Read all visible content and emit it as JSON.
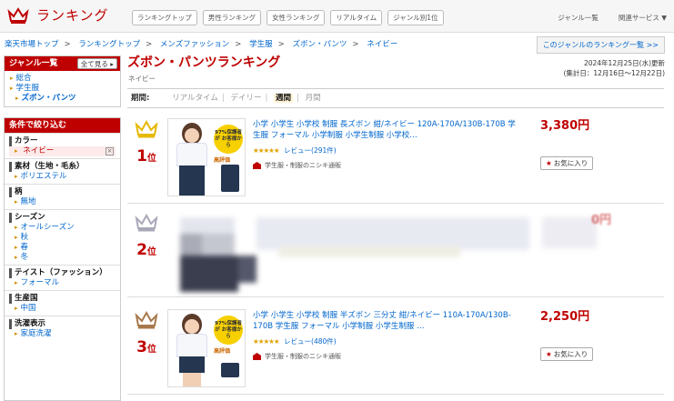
{
  "header": {
    "logo_text": "ランキング",
    "tabs": [
      "ランキングトップ",
      "男性ランキング",
      "女性ランキング",
      "リアルタイム",
      "ジャンル別1位"
    ],
    "right_links": [
      "ジャンル一覧",
      "関連サービス ▼"
    ]
  },
  "breadcrumb": [
    "楽天市場トップ",
    "ランキングトップ",
    "メンズファッション",
    "学生服",
    "ズボン・パンツ",
    "ネイビー"
  ],
  "ranking_link": "このジャンルのランキング一覧 >>",
  "sidebar": {
    "genre_title": "ジャンル一覧",
    "see_all": "全て見る",
    "genre_items": [
      "総合",
      "学生服",
      "ズボン・パンツ"
    ],
    "filter_title": "条件で絞り込む",
    "groups": [
      {
        "title": "カラー",
        "items": [
          "ネイビー"
        ]
      },
      {
        "title": "素材（生地・毛糸）",
        "items": [
          "ポリエステル"
        ]
      },
      {
        "title": "柄",
        "items": [
          "無地"
        ]
      },
      {
        "title": "シーズン",
        "items": [
          "オールシーズン",
          "秋",
          "春",
          "冬"
        ]
      },
      {
        "title": "テイスト（ファッション）",
        "items": [
          "フォーマル"
        ]
      },
      {
        "title": "生産国",
        "items": [
          "中国"
        ]
      },
      {
        "title": "洗濯表示",
        "items": [
          "家庭洗濯"
        ]
      }
    ]
  },
  "main": {
    "title": "ズボン・パンツランキング",
    "subtitle": "ネイビー",
    "updated": "2024年12月25日(水)更新",
    "period_range": "(集計日：12月16日～12月22日)",
    "period_label": "期間:",
    "period_options": [
      "リアルタイム",
      "デイリー",
      "週間",
      "月間"
    ],
    "items": [
      {
        "rank": "1",
        "rank_suffix": "位",
        "title": "小学 小学生 小学校 制服 長ズボン 紺/ネイビー 120A-170A/130B-170B 学生服 フォーマル 小学制服 小学生制服 小学校…",
        "stars": "★★★★★",
        "review": "レビュー(291件)",
        "shop": "学生服・制服のニシキ通販",
        "price": "3,380円",
        "fav": "お気に入り",
        "thumb_badge": "97%保護者が お客様から",
        "thumb_label": "高評価"
      },
      {
        "rank": "2",
        "rank_suffix": "位",
        "price": "0円"
      },
      {
        "rank": "3",
        "rank_suffix": "位",
        "title": "小学 小学生 小学校 制服 半ズボン 三分丈 紺/ネイビー 110A-170A/130B-170B 学生服 フォーマル 小学制服 小学生制服 …",
        "stars": "★★★★★",
        "review": "レビュー(480件)",
        "shop": "学生服・制服のニシキ通販",
        "price": "2,250円",
        "fav": "お気に入り",
        "thumb_badge": "97%保護者が お客様から",
        "thumb_label": "高評価"
      }
    ]
  }
}
